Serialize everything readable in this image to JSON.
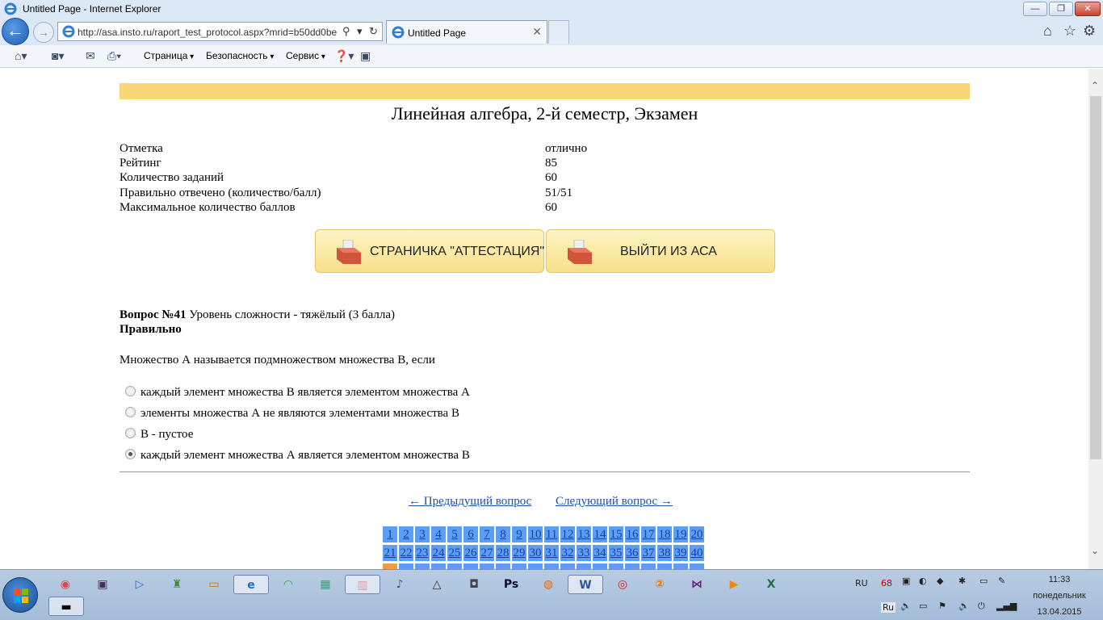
{
  "window": {
    "title": "Untitled Page - Internet Explorer",
    "minimize_glyph": "—",
    "restore_glyph": "❐",
    "close_glyph": "✕"
  },
  "address_bar": {
    "url": "http://asa.insto.ru/raport_test_protocol.aspx?mrid=b50dd0be",
    "search_glyph": "⚲",
    "dropdown_glyph": "▾",
    "refresh_glyph": "↻"
  },
  "tab": {
    "title": "Untitled Page",
    "close_glyph": "✕"
  },
  "browser_icons": [
    "home-icon",
    "favorites-star-icon",
    "tools-gear-icon"
  ],
  "command_bar": {
    "menus": [
      "Страница",
      "Безопасность",
      "Сервис"
    ],
    "icons": [
      "home-icon",
      "rss-feed-icon",
      "mail-icon",
      "print-icon",
      "help-icon",
      "research-icon"
    ]
  },
  "page": {
    "title": "Линейная алгебра, 2-й семестр, Экзамен",
    "info": [
      {
        "label": "Отметка",
        "value": "отлично"
      },
      {
        "label": "Рейтинг",
        "value": "85"
      },
      {
        "label": "Количество заданий",
        "value": "60"
      },
      {
        "label": "Правильно отвечено (количество/балл)",
        "value": "51/51"
      },
      {
        "label": "Максимальное количество баллов",
        "value": "60"
      }
    ],
    "buttons": {
      "attestation": "СТРАНИЧКА \"АТТЕСТАЦИЯ\"",
      "exit": "ВЫЙТИ ИЗ АСА"
    },
    "question": {
      "number_label": "Вопрос №41",
      "difficulty": "Уровень сложности - тяжёлый (3 балла)",
      "status": "Правильно",
      "text": "Множество А называется подмножеством множества В, если",
      "options": [
        "каждый элемент множества В является элементом множества А",
        "элементы множества А не являются элементами множества В",
        "В - пустое",
        "каждый элемент множества А является элементом множества В"
      ],
      "selected_index": 3
    },
    "navigation": {
      "prev": "← Предыдущий вопрос",
      "next": "Следующий вопрос →"
    },
    "question_grid": {
      "row1": [
        "1",
        "2",
        "3",
        "4",
        "5",
        "6",
        "7",
        "8",
        "9",
        "10",
        "11",
        "12",
        "13",
        "14",
        "15",
        "16",
        "17",
        "18",
        "19",
        "20"
      ],
      "row2": [
        "21",
        "22",
        "23",
        "24",
        "25",
        "26",
        "27",
        "28",
        "29",
        "30",
        "31",
        "32",
        "33",
        "34",
        "35",
        "36",
        "37",
        "38",
        "39",
        "40"
      ],
      "colors": {
        "cell": "#5c9ef5",
        "current": "#f39a3e"
      }
    }
  },
  "taskbar": {
    "apps": [
      "chrome-icon",
      "media-icon",
      "player-icon",
      "tool-icon",
      "notes-icon",
      "internet-explorer-icon",
      "wifi-app-icon",
      "screen-icon",
      "explorer-folder-icon",
      "audio-icon",
      "aimp-icon",
      "camera-icon",
      "photoshop-icon",
      "firefox-icon",
      "word-icon",
      "opera-icon",
      "counter-icon",
      "visual-studio-icon",
      "video-icon",
      "excel-icon"
    ],
    "tray": {
      "lang_top": "RU",
      "badge": "68",
      "lang_bottom": "Ru"
    },
    "clock": {
      "time": "11:33",
      "day": "понедельник",
      "date": "13.04.2015"
    }
  }
}
